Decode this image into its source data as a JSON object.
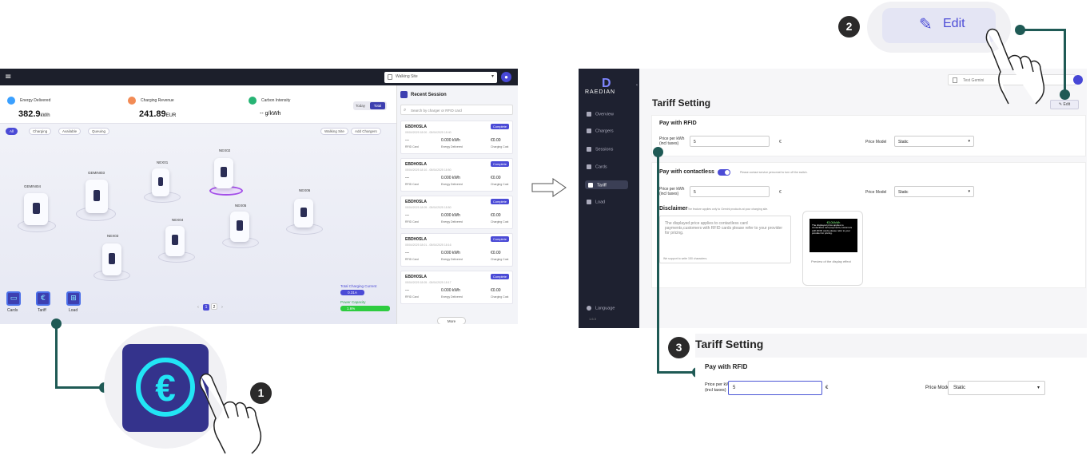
{
  "dashboard": {
    "site_select": "Walking Site",
    "stats": [
      {
        "title": "Energy Delivered",
        "value": "382.9",
        "unit": "kWh",
        "color": "#3aa0ff"
      },
      {
        "title": "Charging Revenue",
        "value": "241.89",
        "unit": "EUR",
        "color": "#f28b55"
      },
      {
        "title": "Carbon Intensity",
        "value": "-- g/kWh",
        "unit": "",
        "color": "#27b474"
      }
    ],
    "toggle_today": "Today",
    "toggle_total": "Total",
    "filters": [
      "All",
      "Charging",
      "Available",
      "Queuing"
    ],
    "walking_site_btn": "Walking Site",
    "add_chargers_btn": "Add Chargers",
    "chargers": [
      "GEMINI04",
      "GEMINI03",
      "NEX01",
      "NEX02",
      "NEX03",
      "NEX04",
      "NEX05",
      "NEX06"
    ],
    "bottom_nav": [
      "Cards",
      "Tariff",
      "Load"
    ],
    "pages": [
      "1",
      "2"
    ],
    "total_current_label": "Total Charging Current",
    "total_current_value": "0.31A",
    "power_capacity_label": "Power Capacity",
    "power_capacity_value": "1.6%",
    "recent_title": "Recent Session",
    "recent_search": "Search by charger or RFID card",
    "sessions": [
      {
        "id": "EBDH0SLA",
        "status": "Complete",
        "time": "05/04/2025 18:00 - 05/04/2025 18:40",
        "card": "RFID Card",
        "energy": "0.000",
        "cost": "€0.00"
      },
      {
        "id": "EBDH0SLA",
        "status": "Complete",
        "time": "05/04/2025 18:10 - 05/04/2025 18:50",
        "card": "RFID Card",
        "energy": "0.000",
        "cost": "€0.00"
      },
      {
        "id": "EBDH0SLA",
        "status": "Complete",
        "time": "05/04/2025 18:05 - 05/04/2025 18:50",
        "card": "RFID Card",
        "energy": "0.000",
        "cost": "€0.00"
      },
      {
        "id": "EBDH0SLA",
        "status": "Complete",
        "time": "05/04/2025 18:01 - 05/04/2025 18:16",
        "card": "RFID Card",
        "energy": "0.000",
        "cost": "€0.00"
      },
      {
        "id": "EBDH0SLA",
        "status": "Complete",
        "time": "05/04/2025 18:05 - 05/04/2025 18:17",
        "card": "RFID Card",
        "energy": "0.000",
        "cost": "€0.00"
      }
    ],
    "dash": "---",
    "energy_unit": "kWh",
    "energy_label": "Energy Delivered",
    "cost_label": "Charging Cost",
    "more_btn": "More"
  },
  "callouts": {
    "step1": "1",
    "step2": "2",
    "step3": "3",
    "edit_label": "Edit",
    "euro_glyph": "€"
  },
  "tariff": {
    "logo": "RAEDIAN",
    "nav": [
      "Overview",
      "Chargers",
      "Sessions",
      "Cards",
      "Tariff",
      "Load"
    ],
    "language": "Language",
    "version": "1.6.3",
    "site": "Test Gemini",
    "title": "Tariff Setting",
    "edit_btn": "Edit",
    "rfid_title": "Pay with RFID",
    "price_label_1": "Price per kWh",
    "price_label_2": "(incl taxes)",
    "rfid_price": "5",
    "currency": "€",
    "price_model_label": "Price Model",
    "price_model": "Static",
    "contactless_title": "Pay with contactless",
    "contactless_note": "Please contact service personnel to turn off the switch.",
    "contactless_price": "5",
    "disclaimer_title": "Disclaimer",
    "disclaimer_note": "The feature applies only to Gemini products at your charging site.",
    "disclaimer_text": "The displayed price applies to contactless card payments,customers with RFID cards please refer to your provider for pricing.",
    "char_note": "We support to write 150 characters.",
    "preview_label": "Preview of the display effect",
    "preview_screen_title": "€5.00/kWh",
    "preview_screen_text": "The displayed price applies to contactless card payments,customers with RFID cards please refer to your provider for pricing."
  },
  "zoom_tariff": {
    "title": "Tariff Setting",
    "rfid_title": "Pay with RFID",
    "price_label_1": "Price per kWh",
    "price_label_2": "(incl taxes)",
    "price": "5",
    "currency": "€",
    "price_model_label": "Price Model",
    "price_model": "Static"
  }
}
